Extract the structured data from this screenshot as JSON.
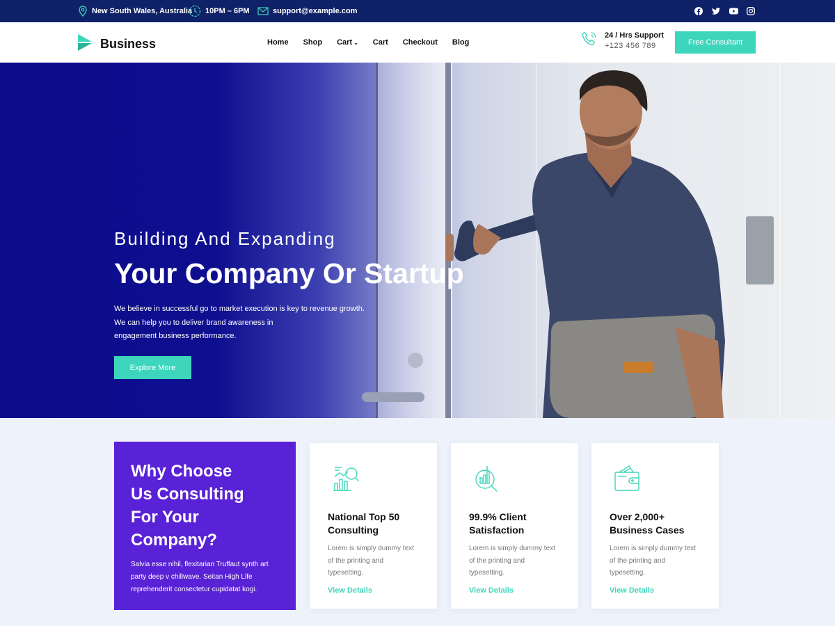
{
  "colors": {
    "topbar_bg": "#0f2167",
    "accent": "#3dd6bc",
    "purple": "#5a22d6",
    "hero_blue": "#0c0d8a"
  },
  "topbar": {
    "location": "New South Wales, Australia",
    "hours": "10PM – 6PM",
    "email": "support@example.com",
    "location_icon": "map-pin-icon",
    "hours_icon": "clock-icon",
    "email_icon": "envelope-icon",
    "social_icons": [
      "facebook-icon",
      "twitter-icon",
      "youtube-icon",
      "instagram-icon"
    ]
  },
  "header": {
    "logo_text": "Business",
    "nav": [
      {
        "label": "Home"
      },
      {
        "label": "Shop"
      },
      {
        "label": "Cart",
        "dropdown": true
      },
      {
        "label": "Cart"
      },
      {
        "label": "Checkout"
      },
      {
        "label": "Blog"
      }
    ],
    "support_title": "24 / Hrs Support",
    "support_phone": "+123 456 789",
    "support_icon": "phone-icon",
    "cta": "Free Consultant"
  },
  "hero": {
    "subtitle": "Building And Expanding",
    "title": "Your Company Or Startup",
    "text_lines": [
      "We believe in successful go to market execution is key to revenue growth.",
      "We can help you to deliver brand awareness in",
      "engagement business performance."
    ],
    "button": "Explore More"
  },
  "why": {
    "title_lines": [
      "Why Choose",
      "Us Consulting",
      "For Your",
      "Company?"
    ],
    "text": "Salvia esse nihil, flexitarian Truffaut synth art party deep v chillwave. Seitan High Life reprehenderit consectetur cupidatat kogi."
  },
  "cards": [
    {
      "icon": "chart-magnifier-icon",
      "title_lines": [
        "National Top 50",
        "Consulting"
      ],
      "text_lines": [
        "Lorem is simply dummy text",
        "of the printing and",
        "typesetting."
      ],
      "link": "View Details"
    },
    {
      "icon": "analytics-search-icon",
      "title_lines": [
        "99.9% Client",
        "Satisfaction"
      ],
      "text_lines": [
        "Lorem is simply dummy text",
        "of the printing and",
        "typesetting."
      ],
      "link": "View Details"
    },
    {
      "icon": "wallet-icon",
      "title_lines": [
        "Over 2,000+",
        "Business Cases"
      ],
      "text_lines": [
        "Lorem is simply dummy text",
        "of the printing and",
        "typesetting."
      ],
      "link": "View Details"
    }
  ]
}
